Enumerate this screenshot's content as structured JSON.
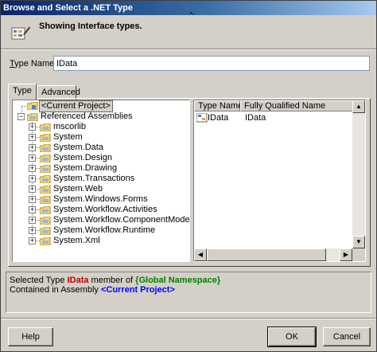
{
  "window": {
    "title": "Browse and Select a .NET Type"
  },
  "header": {
    "text": "Showing Interface types."
  },
  "type_name": {
    "label_prefix": "T",
    "label_rest": "ype Name:",
    "value": "IData"
  },
  "tabs": [
    {
      "label": "Type"
    },
    {
      "label": "Advanced"
    }
  ],
  "tree": {
    "current_project": "<Current Project>",
    "referenced_assemblies": "Referenced Assemblies",
    "assemblies": [
      "mscorlib",
      "System",
      "System.Data",
      "System.Design",
      "System.Drawing",
      "System.Transactions",
      "System.Web",
      "System.Windows.Forms",
      "System.Workflow.Activities",
      "System.Workflow.ComponentModel",
      "System.Workflow.Runtime",
      "System.Xml"
    ]
  },
  "list": {
    "columns": [
      "Type Name",
      "Fully Qualified Name"
    ],
    "rows": [
      {
        "type_name": "IData",
        "fully_qualified": "IData"
      }
    ]
  },
  "info": {
    "line1_prefix": "Selected Type ",
    "line1_type": "IData",
    "line1_mid": " member of ",
    "line1_namespace": "{Global Namespace}",
    "line2_prefix": "Contained in Assembly ",
    "line2_assembly": "<Current Project>"
  },
  "buttons": {
    "help": "Help",
    "ok": "OK",
    "cancel": "Cancel"
  },
  "colors": {
    "title_bar": "#0a246a",
    "type_highlight": "#c00000",
    "namespace_highlight": "#008000",
    "assembly_highlight": "#0000ff",
    "dialog_face": "#d4d0c8"
  },
  "icons": {
    "header": "interface-browse-icon",
    "folder": "folder-icon",
    "interface": "interface-type-icon"
  }
}
